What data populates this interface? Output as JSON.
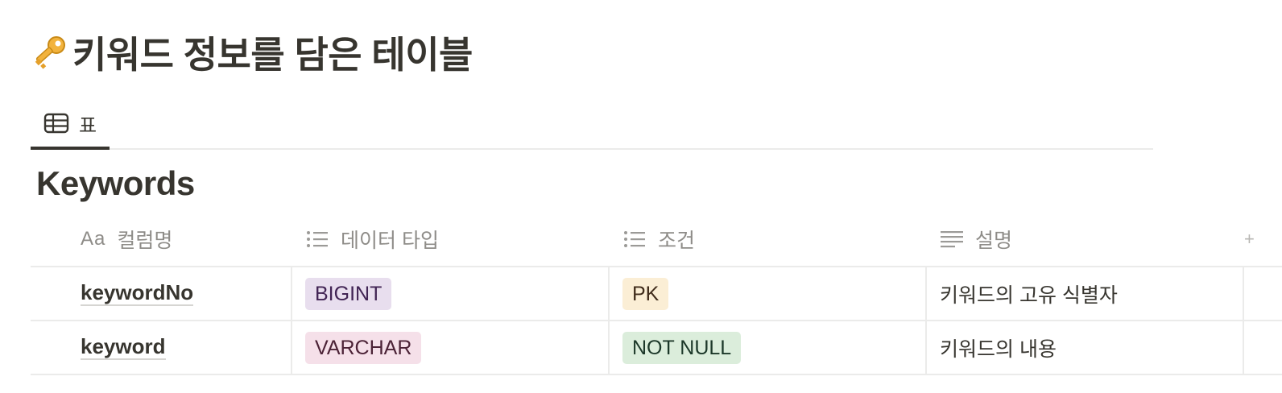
{
  "page": {
    "title": "키워드 정보를 담은 테이블",
    "title_icon": "key-icon"
  },
  "tabs": [
    {
      "label": "표",
      "icon": "table-icon",
      "active": true
    }
  ],
  "database": {
    "title": "Keywords",
    "columns": [
      {
        "label": "컬럼명",
        "icon": "Aa"
      },
      {
        "label": "데이터 타입",
        "icon": "list-icon"
      },
      {
        "label": "조건",
        "icon": "list-icon"
      },
      {
        "label": "설명",
        "icon": "text-icon"
      }
    ],
    "rows": [
      {
        "name": "keywordNo",
        "type": "BIGINT",
        "type_color": "#e8deee",
        "condition": "PK",
        "condition_color": "#fbeed5",
        "description": "키워드의 고유 식별자"
      },
      {
        "name": "keyword",
        "type": "VARCHAR",
        "type_color": "#f5e0e9",
        "condition": "NOT NULL",
        "condition_color": "#dbeddb",
        "description": "키워드의 내용"
      }
    ]
  },
  "colors": {
    "text": "#37352f",
    "muted": "#8e8c88",
    "border": "#ebebea"
  }
}
